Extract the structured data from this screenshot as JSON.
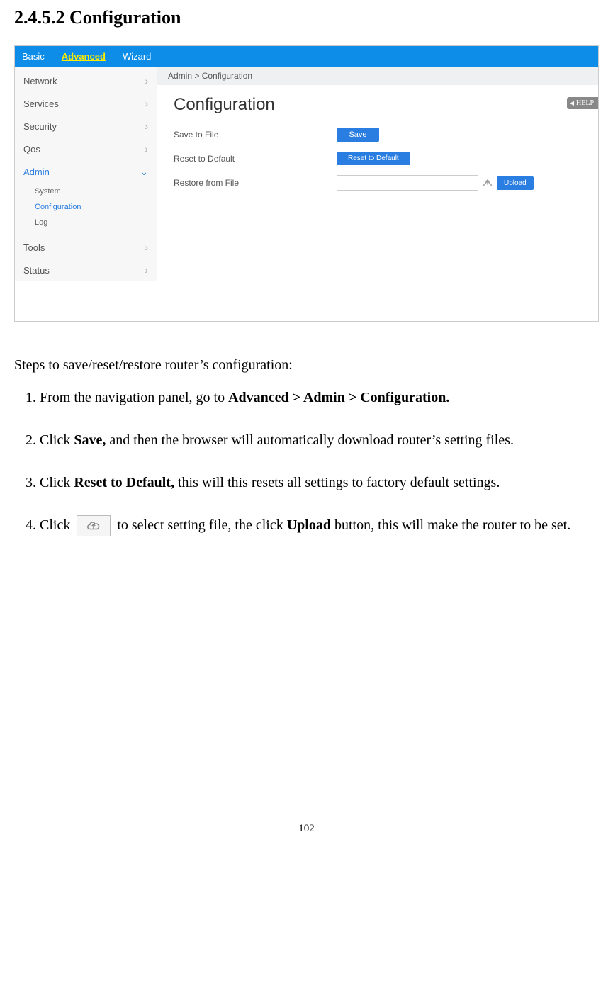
{
  "heading": "2.4.5.2 Configuration",
  "tabs": {
    "basic": "Basic",
    "advanced": "Advanced",
    "wizard": "Wizard"
  },
  "sidebar": {
    "network": "Network",
    "services": "Services",
    "security": "Security",
    "qos": "Qos",
    "admin": "Admin",
    "system": "System",
    "configuration": "Configuration",
    "log": "Log",
    "tools": "Tools",
    "status": "Status"
  },
  "breadcrumb": "Admin > Configuration",
  "page_title": "Configuration",
  "rows": {
    "save_label": "Save to File",
    "save_btn": "Save",
    "reset_label": "Reset to Default",
    "reset_btn": "Reset to Default",
    "restore_label": "Restore from File",
    "upload_btn": "Upload"
  },
  "help": "HELP",
  "intro": "Steps to save/reset/restore router’s configuration:",
  "steps": {
    "s1_pre": "From the navigation panel, go to ",
    "s1_bold": "Advanced > Admin > Configuration.",
    "s2_pre": "Click ",
    "s2_bold": "Save,",
    "s2_post": " and then the browser will automatically download router’s setting files.",
    "s3_pre": "Click ",
    "s3_bold": "Reset to Default,",
    "s3_post": " this will this resets all settings to factory default settings.",
    "s4_pre": "Click ",
    "s4_mid": " to select setting file, the click ",
    "s4_bold": "Upload",
    "s4_post": " button, this will make the router to be set."
  },
  "page_number": "102"
}
